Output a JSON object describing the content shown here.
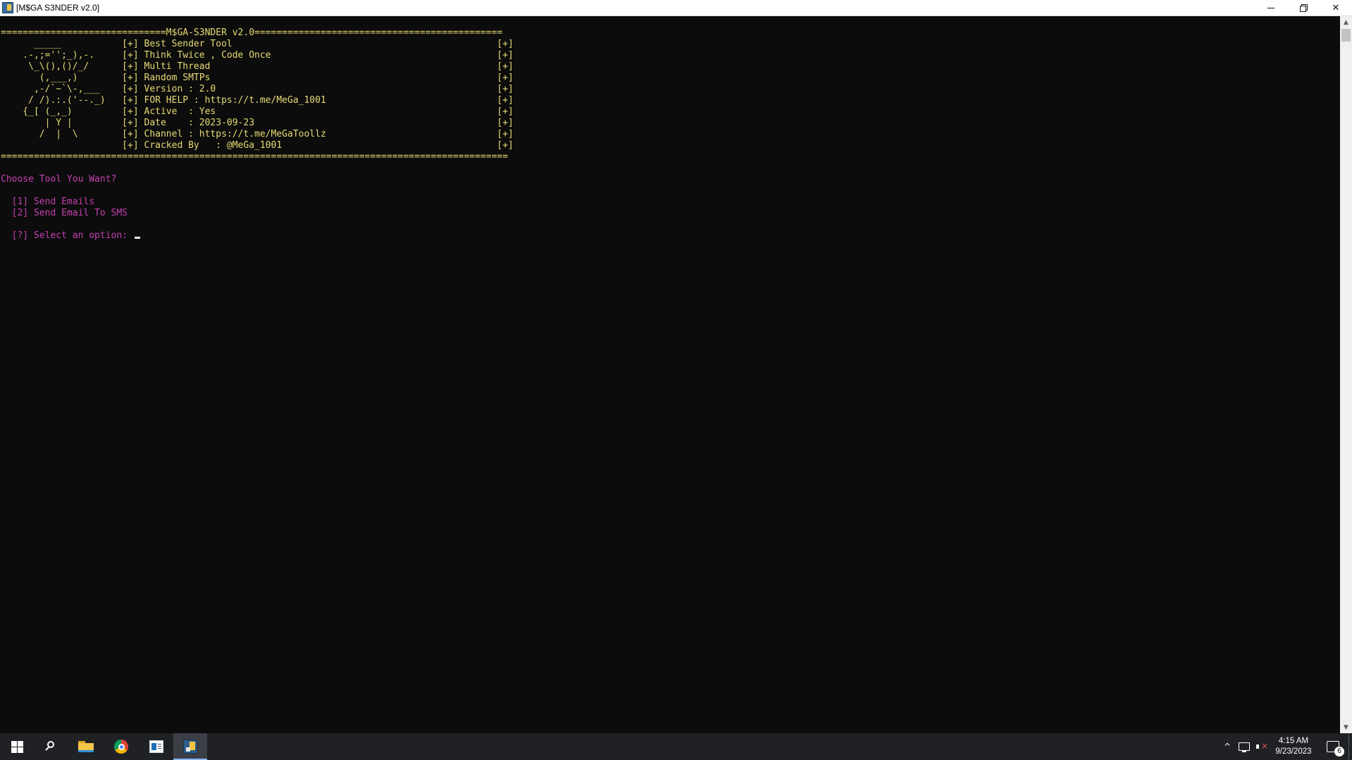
{
  "window": {
    "title": "[M$GA S3NDER v2.0]",
    "controls": {
      "minimize": "minimize",
      "restore": "restore",
      "close": "✕"
    }
  },
  "console": {
    "banner_top": "==============================M$GA-S3NDER v2.0=============================================",
    "banner_lines": [
      "      _____           [+] Best Sender Tool                                                [+]",
      "    .-,;='';_),-.     [+] Think Twice , Code Once                                         [+]",
      "     \\_\\(),()/_/      [+] Multi Thread                                                    [+]",
      "       (,___,)        [+] Random SMTPs                                                    [+]",
      "      ,-/`~`\\-,___    [+] Version : 2.0                                                   [+]",
      "     / /).:.('--._)   [+] FOR HELP : https://t.me/MeGa_1001                               [+]",
      "    {_[ (_,_)         [+] Active  : Yes                                                   [+]",
      "        | Y |         [+] Date    : 2023-09-23                                            [+]",
      "       /  |  \\        [+] Channel : https://t.me/MeGaToollz                               [+]",
      "                      [+] Cracked By   : @MeGa_1001                                       [+]"
    ],
    "banner_bottom": "============================================================================================",
    "prompt_heading": "Choose Tool You Want?",
    "options": [
      "  [1] Send Emails",
      "  [2] Send Email To SMS"
    ],
    "select_prompt": "  [?] Select an option: ",
    "colors": {
      "background": "#0c0c0c",
      "banner": "#e6db74",
      "menu": "#c53fb0"
    }
  },
  "taskbar": {
    "icons": [
      "windows-start-icon",
      "search-icon",
      "file-explorer-icon",
      "chrome-icon",
      "app-icon",
      "console-app-icon"
    ],
    "tray": {
      "chevron": "^",
      "time": "4:15 AM",
      "date": "9/23/2023",
      "notification_count": "6"
    }
  }
}
